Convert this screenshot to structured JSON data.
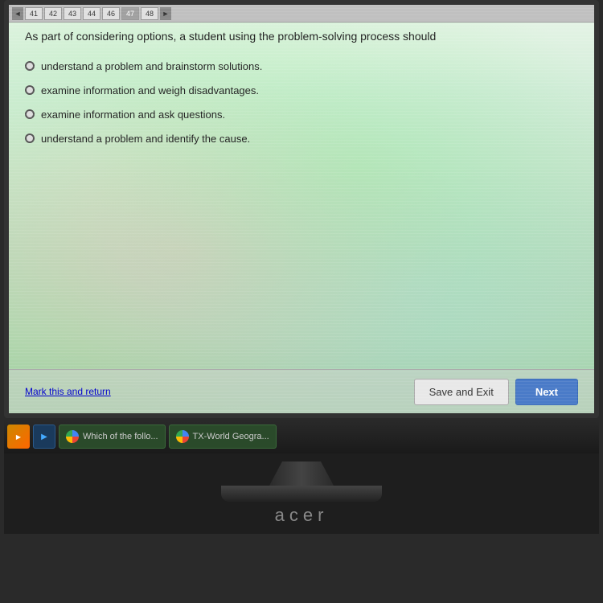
{
  "screen": {
    "top_nav": {
      "arrows": [
        "◄",
        "►"
      ],
      "question_numbers": [
        "41",
        "42",
        "43",
        "44",
        "46",
        "47",
        "48"
      ]
    },
    "question": {
      "text": "As part of considering options, a student using the problem-solving process should",
      "options": [
        "understand a problem and brainstorm solutions.",
        "examine information and weigh disadvantages.",
        "examine information and ask questions.",
        "understand a problem and identify the cause."
      ]
    },
    "action_bar": {
      "mark_link": "Mark this and return",
      "save_exit_btn": "Save and Exit",
      "next_btn": "Next"
    }
  },
  "taskbar": {
    "tabs": [
      {
        "label": "Which of the follo..."
      },
      {
        "label": "TX-World Geogra..."
      }
    ]
  },
  "monitor": {
    "brand": "acer"
  }
}
